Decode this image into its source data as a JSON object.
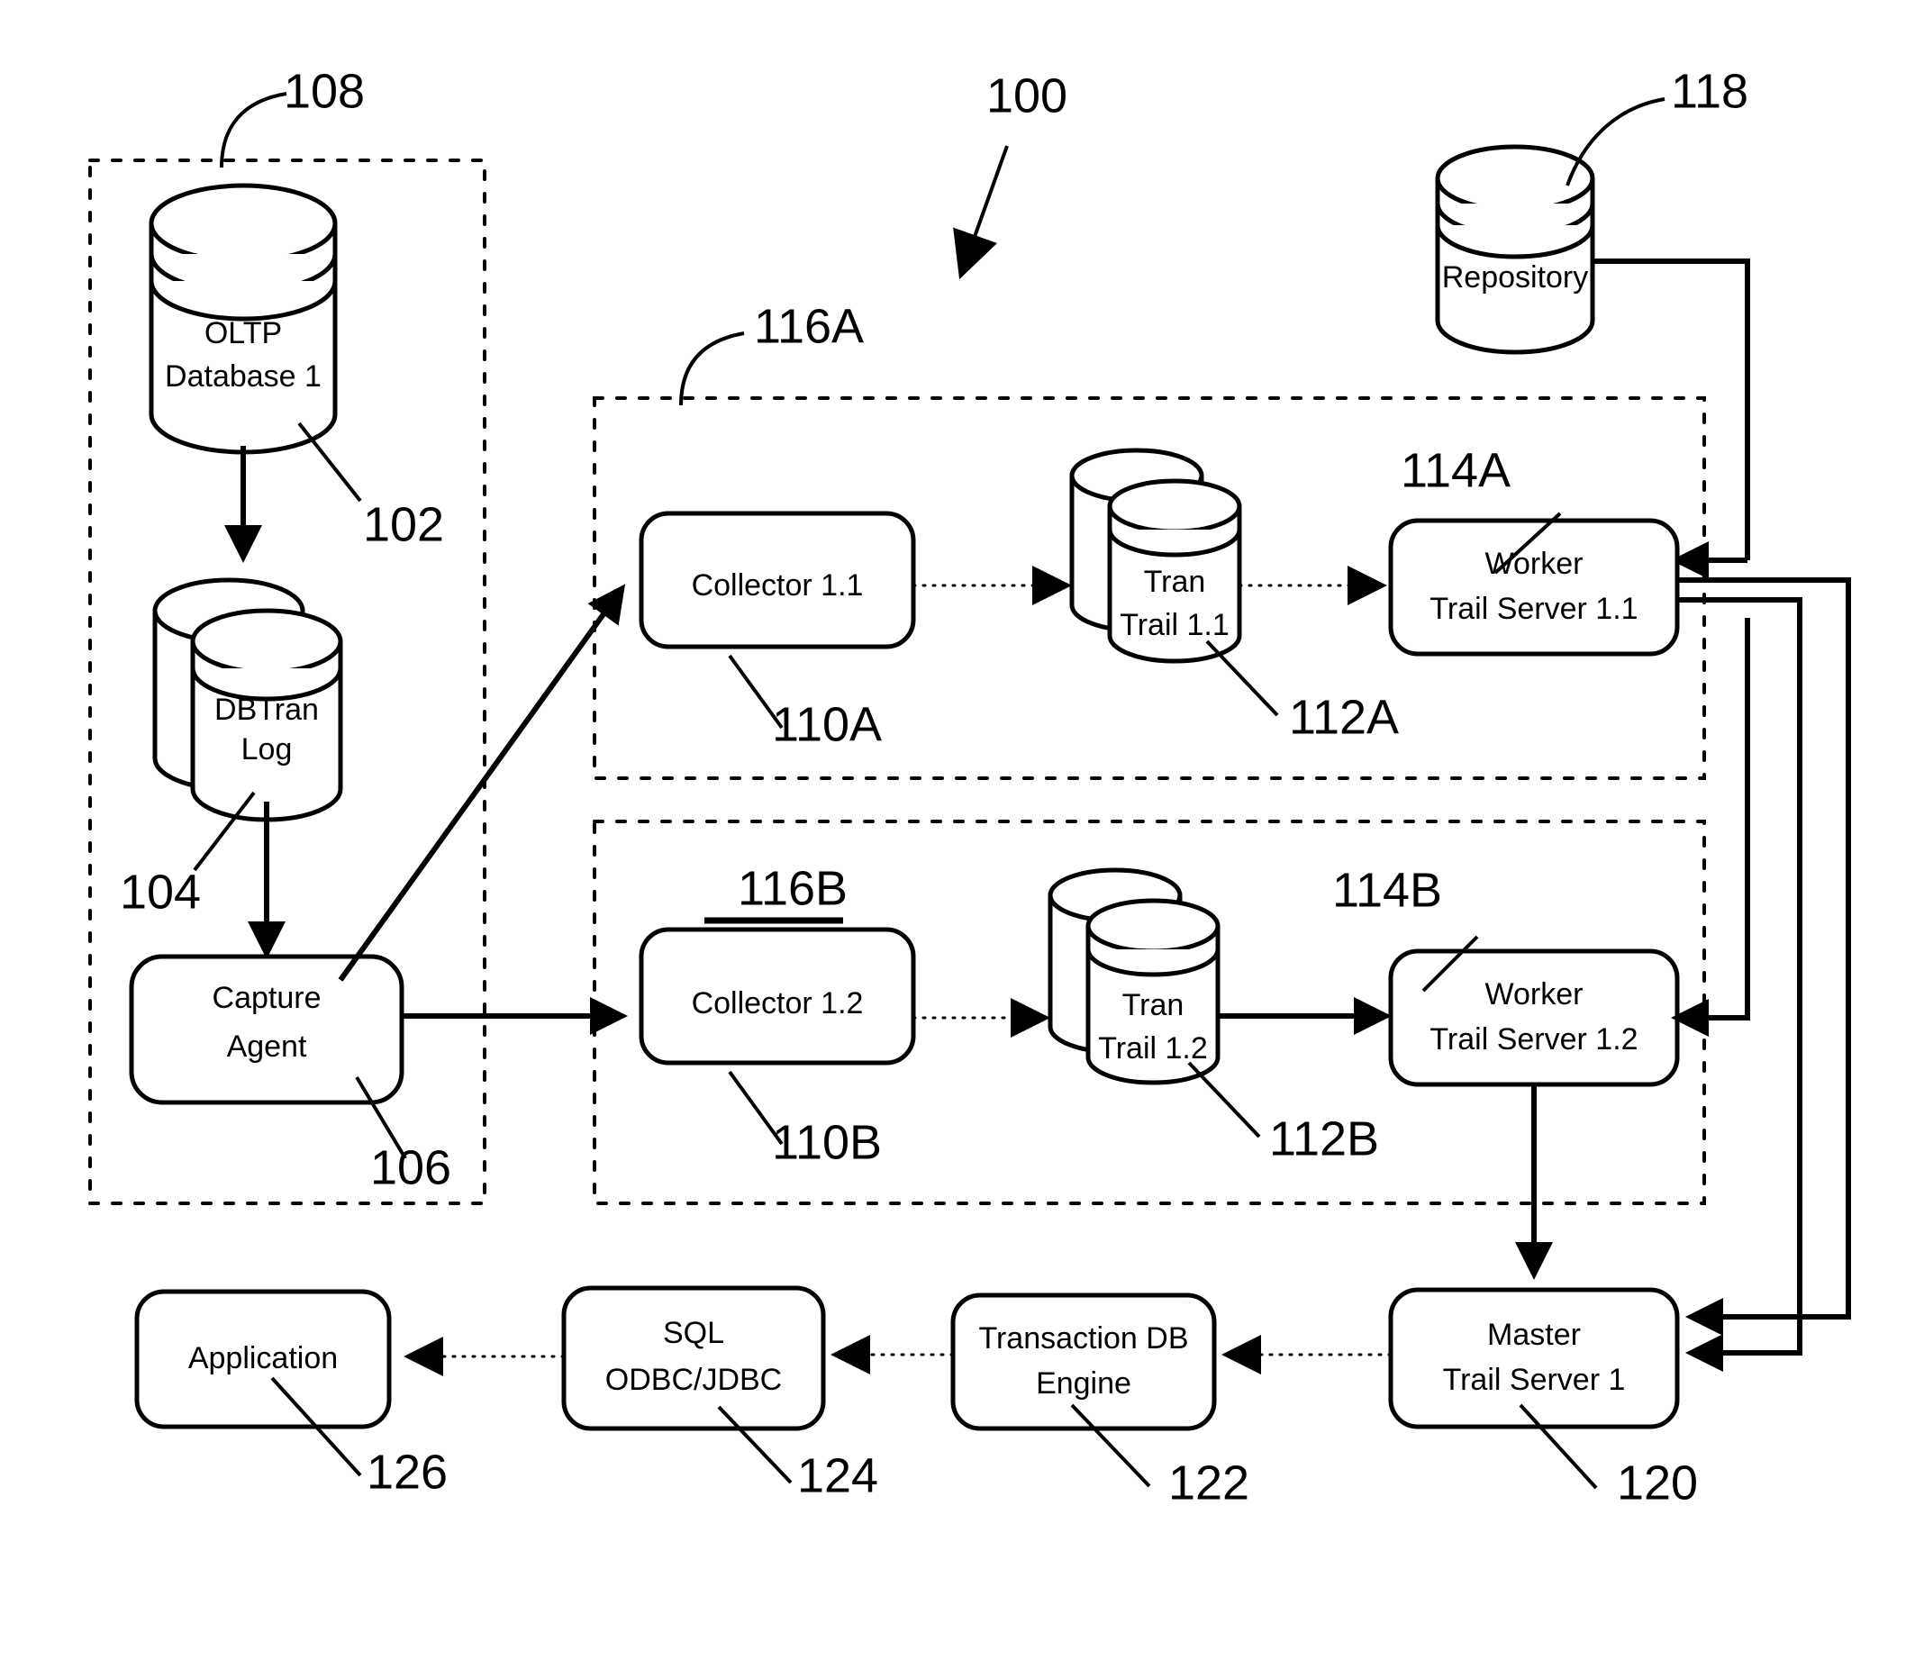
{
  "figure": {
    "title_ref": "100",
    "style": "patent-line-drawing",
    "background": "#ffffff",
    "ink": "#000000"
  },
  "groups": [
    {
      "id": "source-group",
      "ref": "108",
      "underlined": false
    },
    {
      "id": "collector-group-a",
      "ref": "116A",
      "underlined": false
    },
    {
      "id": "collector-group-b",
      "ref": "116B",
      "underlined": true
    }
  ],
  "nodes": {
    "oltp_database": {
      "label_line1": "OLTP",
      "label_line2": "Database 1",
      "ref": "102",
      "shape": "cylinder"
    },
    "dbtran_log": {
      "label_line1": "DBTran",
      "label_line2": "Log",
      "ref": "104",
      "shape": "stacked-cylinder"
    },
    "capture_agent": {
      "label_line1": "Capture",
      "label_line2": "Agent",
      "ref": "106",
      "shape": "rounded-box"
    },
    "collector_1_1": {
      "label_line1": "Collector 1.1",
      "label_line2": "",
      "ref": "110A",
      "shape": "rounded-box"
    },
    "tran_trail_1_1": {
      "label_line1": "Tran",
      "label_line2": "Trail 1.1",
      "ref": "112A",
      "shape": "stacked-cylinder"
    },
    "worker_trail_server_1_1": {
      "label_line1": "Worker",
      "label_line2": "Trail Server 1.1",
      "ref": "114A",
      "shape": "rounded-box"
    },
    "collector_1_2": {
      "label_line1": "Collector 1.2",
      "label_line2": "",
      "ref": "110B",
      "shape": "rounded-box"
    },
    "tran_trail_1_2": {
      "label_line1": "Tran",
      "label_line2": "Trail 1.2",
      "ref": "112B",
      "shape": "stacked-cylinder"
    },
    "worker_trail_server_1_2": {
      "label_line1": "Worker",
      "label_line2": "Trail Server 1.2",
      "ref": "114B",
      "shape": "rounded-box"
    },
    "repository": {
      "label_line1": "Repository",
      "label_line2": "",
      "ref": "118",
      "shape": "cylinder"
    },
    "master_trail_server_1": {
      "label_line1": "Master",
      "label_line2": "Trail Server 1",
      "ref": "120",
      "shape": "rounded-box"
    },
    "transaction_db_engine": {
      "label_line1": "Transaction DB",
      "label_line2": "Engine",
      "ref": "122",
      "shape": "rounded-box"
    },
    "sql_odbc_jdbc": {
      "label_line1": "SQL",
      "label_line2": "ODBC/JDBC",
      "ref": "124",
      "shape": "rounded-box"
    },
    "application": {
      "label_line1": "Application",
      "label_line2": "",
      "ref": "126",
      "shape": "rounded-box"
    }
  },
  "reference_numerals": [
    "100",
    "102",
    "104",
    "106",
    "108",
    "110A",
    "110B",
    "112A",
    "112B",
    "114A",
    "114B",
    "116A",
    "116B",
    "118",
    "120",
    "122",
    "124",
    "126"
  ],
  "connections": [
    {
      "from": "oltp_database",
      "to": "dbtran_log",
      "style": "solid-arrow"
    },
    {
      "from": "dbtran_log",
      "to": "capture_agent",
      "style": "solid-arrow"
    },
    {
      "from": "capture_agent",
      "to": "collector_1_1",
      "style": "solid-arrow-diagonal"
    },
    {
      "from": "capture_agent",
      "to": "collector_1_2",
      "style": "solid-arrow"
    },
    {
      "from": "collector_1_1",
      "to": "tran_trail_1_1",
      "style": "dotted-arrow"
    },
    {
      "from": "tran_trail_1_1",
      "to": "worker_trail_server_1_1",
      "style": "dotted-arrow"
    },
    {
      "from": "collector_1_2",
      "to": "tran_trail_1_2",
      "style": "dotted-arrow"
    },
    {
      "from": "tran_trail_1_2",
      "to": "worker_trail_server_1_2",
      "style": "solid-arrow"
    },
    {
      "from": "repository",
      "to": "worker_trail_server_1_1",
      "style": "solid-routed-arrow"
    },
    {
      "from": "repository",
      "to": "master_trail_server_1",
      "style": "solid-routed-arrow"
    },
    {
      "from": "worker_trail_server_1_1",
      "to": "master_trail_server_1",
      "style": "solid-routed-arrow"
    },
    {
      "from": "worker_trail_server_1_2",
      "to": "master_trail_server_1",
      "style": "solid-arrow"
    },
    {
      "from": "master_trail_server_1",
      "to": "transaction_db_engine",
      "style": "dotted-arrow"
    },
    {
      "from": "transaction_db_engine",
      "to": "sql_odbc_jdbc",
      "style": "dotted-arrow"
    },
    {
      "from": "sql_odbc_jdbc",
      "to": "application",
      "style": "dotted-arrow"
    }
  ]
}
